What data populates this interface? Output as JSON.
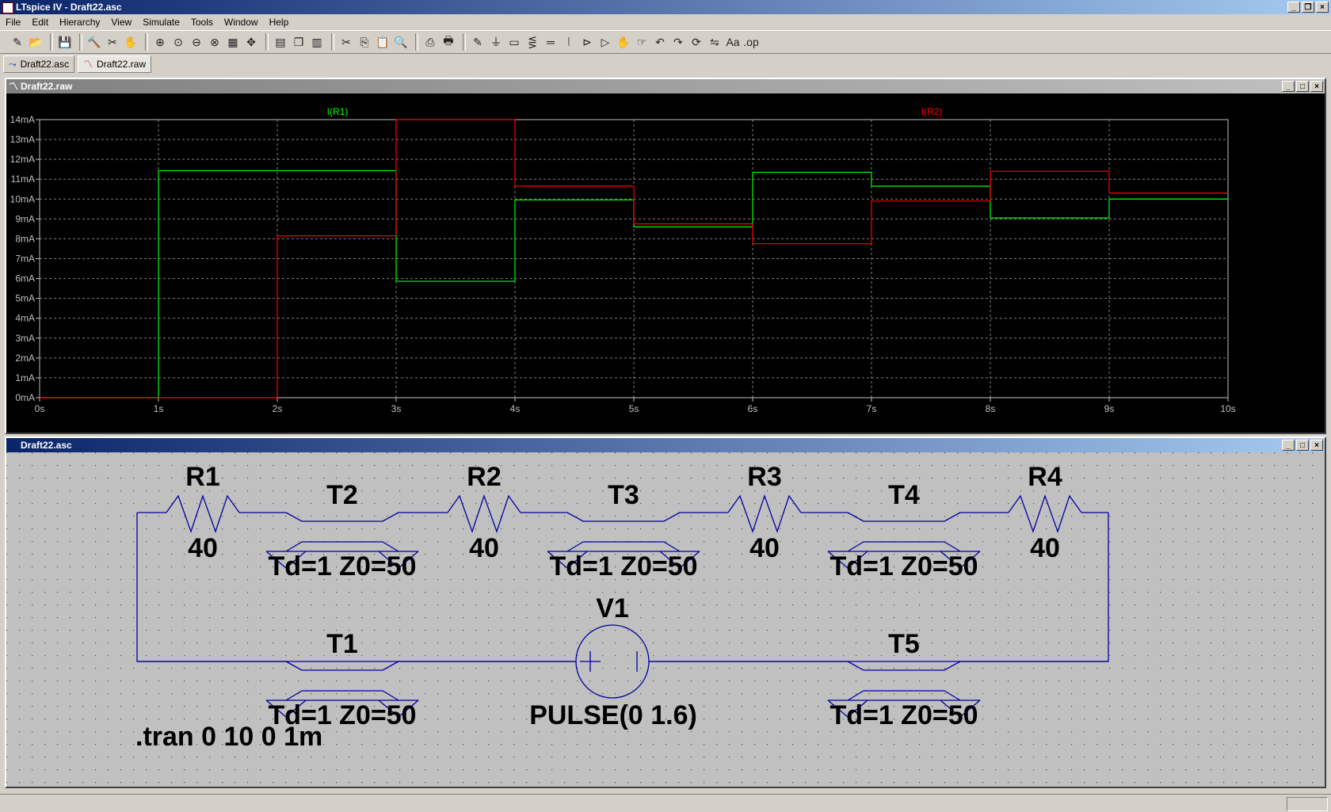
{
  "app": {
    "title": "LTspice IV - Draft22.asc"
  },
  "menu": [
    "File",
    "Edit",
    "Hierarchy",
    "View",
    "Simulate",
    "Tools",
    "Window",
    "Help"
  ],
  "toolbar_icons": [
    "new-schematic-icon",
    "open-icon",
    "save-icon",
    "control-panel-icon",
    "run-icon",
    "halt-icon",
    "zoom-in-icon",
    "zoom-full-icon",
    "zoom-out-icon",
    "zoom-cancel-icon",
    "autorange-icon",
    "pan-icon",
    "tile-horizontal-icon",
    "cascade-icon",
    "tile-vertical-icon",
    "cut-icon",
    "copy-icon",
    "paste-icon",
    "find-icon",
    "print-preview-icon",
    "print-icon",
    "wire-icon",
    "ground-icon",
    "label-icon",
    "resistor-icon",
    "capacitor-icon",
    "inductor-icon",
    "diode-icon",
    "component-icon",
    "move-icon",
    "drag-icon",
    "undo-icon",
    "redo-icon",
    "rotate-icon",
    "mirror-icon",
    "text-icon",
    "spice-directive-icon"
  ],
  "toolbar_glyphs": [
    "✎",
    "📂",
    "💾",
    "🔨",
    "✂",
    "✋",
    "⊕",
    "⊙",
    "⊖",
    "⊗",
    "▦",
    "✥",
    "▤",
    "❐",
    "▥",
    "✂",
    "⎘",
    "📋",
    "🔍",
    "⎙",
    "🖶",
    "✎",
    "⏚",
    "▭",
    "⋚",
    "═",
    "⦚",
    "⊳",
    "▷",
    "✋",
    "☞",
    "↶",
    "↷",
    "⟳",
    "⇋",
    "Aa",
    ".op"
  ],
  "tabs": [
    {
      "label": "Draft22.asc",
      "icon": "schematic-icon"
    },
    {
      "label": "Draft22.raw",
      "icon": "waveform-icon"
    }
  ],
  "plot_window": {
    "title": "Draft22.raw"
  },
  "schematic_window": {
    "title": "Draft22.asc"
  },
  "chart_data": {
    "type": "line",
    "background": "#000000",
    "grid": true,
    "x_ticks": [
      "0s",
      "1s",
      "2s",
      "3s",
      "4s",
      "5s",
      "6s",
      "7s",
      "8s",
      "9s",
      "10s"
    ],
    "y_ticks": [
      "0mA",
      "1mA",
      "2mA",
      "3mA",
      "4mA",
      "5mA",
      "6mA",
      "7mA",
      "8mA",
      "9mA",
      "10mA",
      "11mA",
      "12mA",
      "13mA",
      "14mA"
    ],
    "xlim": [
      0,
      10
    ],
    "ylim": [
      0,
      14
    ],
    "series": [
      {
        "name": "I(R1)",
        "color": "#00ff00",
        "step": true,
        "x": [
          0,
          1,
          3,
          4,
          5,
          6,
          7,
          8,
          9,
          10
        ],
        "y": [
          0,
          11.43,
          5.86,
          9.96,
          8.6,
          11.35,
          10.65,
          9.05,
          10.0,
          10.0
        ]
      },
      {
        "name": "I(R2)",
        "color": "#ff0000",
        "step": true,
        "x": [
          0,
          2,
          3,
          4,
          5,
          6,
          7,
          8,
          9,
          10
        ],
        "y": [
          0,
          8.15,
          14.0,
          10.65,
          8.75,
          7.75,
          9.9,
          11.4,
          10.3,
          10.3
        ]
      }
    ]
  },
  "schematic": {
    "components": [
      {
        "ref": "R1",
        "value": "40"
      },
      {
        "ref": "R2",
        "value": "40"
      },
      {
        "ref": "R3",
        "value": "40"
      },
      {
        "ref": "R4",
        "value": "40"
      },
      {
        "ref": "T1",
        "value": "Td=1 Z0=50"
      },
      {
        "ref": "T2",
        "value": "Td=1 Z0=50"
      },
      {
        "ref": "T3",
        "value": "Td=1 Z0=50"
      },
      {
        "ref": "T4",
        "value": "Td=1 Z0=50"
      },
      {
        "ref": "T5",
        "value": "Td=1 Z0=50"
      },
      {
        "ref": "V1",
        "value": "PULSE(0 1.6)"
      }
    ],
    "directive": ".tran 0 10 0 1m",
    "wire_color": "#00009f"
  }
}
